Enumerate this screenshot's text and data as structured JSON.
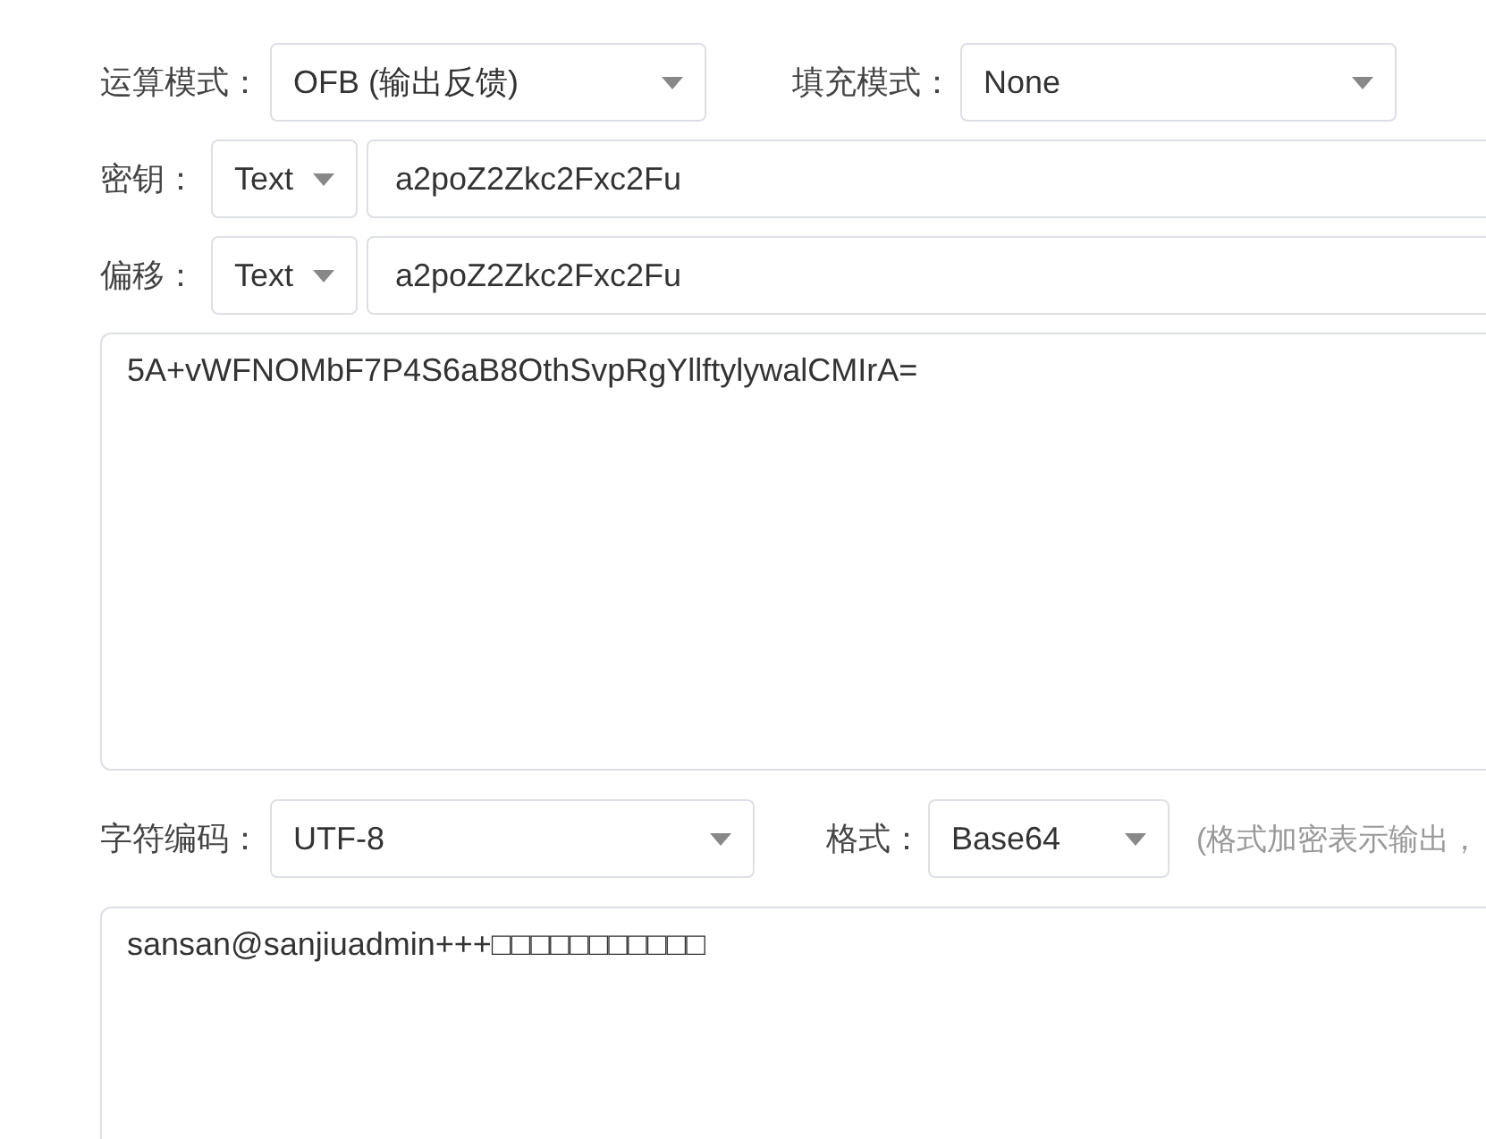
{
  "mode": {
    "label": "运算模式：",
    "value": "OFB (输出反馈)"
  },
  "padding": {
    "label": "填充模式：",
    "value": "None"
  },
  "key": {
    "label": "密钥：",
    "type": "Text",
    "value": "a2poZ2Zkc2Fxc2Fu"
  },
  "iv": {
    "label": "偏移：",
    "type": "Text",
    "value": "a2poZ2Zkc2Fxc2Fu"
  },
  "ciphertext": "5A+vWFNOMbF7P4S6aB8OthSvpRgYllftylywalCMIrA=",
  "charset": {
    "label": "字符编码：",
    "value": "UTF-8"
  },
  "format": {
    "label": "格式：",
    "value": "Base64",
    "hint": "(格式加密表示输出，"
  },
  "plaintext": "sansan@sanjiuadmin+++□□□□□□□□□□□"
}
